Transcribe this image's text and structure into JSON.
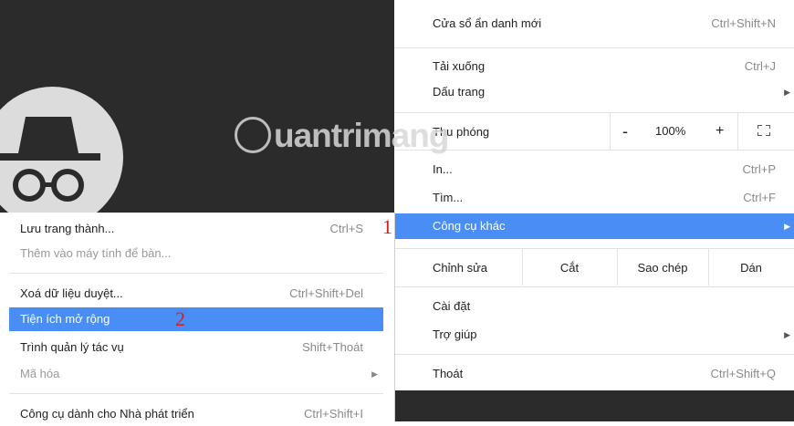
{
  "watermark": {
    "text": "uantrimang"
  },
  "main_menu": {
    "new_incognito": {
      "label": "Cửa sổ ẩn danh mới",
      "shortcut": "Ctrl+Shift+N"
    },
    "downloads": {
      "label": "Tải xuống",
      "shortcut": "Ctrl+J"
    },
    "bookmarks": {
      "label": "Dấu trang"
    },
    "zoom": {
      "label": "Thu phóng",
      "minus": "-",
      "value": "100%",
      "plus": "+"
    },
    "print": {
      "label": "In...",
      "shortcut": "Ctrl+P"
    },
    "find": {
      "label": "Tìm...",
      "shortcut": "Ctrl+F"
    },
    "more_tools": {
      "label": "Công cụ khác"
    },
    "edit": {
      "label": "Chỉnh sửa",
      "cut": "Cắt",
      "copy": "Sao chép",
      "paste": "Dán"
    },
    "settings": {
      "label": "Cài đặt"
    },
    "help": {
      "label": "Trợ giúp"
    },
    "exit": {
      "label": "Thoát",
      "shortcut": "Ctrl+Shift+Q"
    }
  },
  "sub_menu": {
    "save_page": {
      "label": "Lưu trang thành...",
      "shortcut": "Ctrl+S"
    },
    "add_desktop": {
      "label": "Thêm vào máy tính để bàn..."
    },
    "clear_data": {
      "label": "Xoá dữ liệu duyệt...",
      "shortcut": "Ctrl+Shift+Del"
    },
    "extensions": {
      "label": "Tiện ích mở rộng"
    },
    "task_manager": {
      "label": "Trình quản lý tác vụ",
      "shortcut": "Shift+Thoát"
    },
    "encoding": {
      "label": "Mã hóa"
    },
    "dev_tools": {
      "label": "Công cụ dành cho Nhà phát triển",
      "shortcut": "Ctrl+Shift+I"
    }
  },
  "annotations": {
    "step1": "1",
    "step2": "2"
  },
  "colors": {
    "highlight": "#4a8ef5",
    "marker": "#d42020",
    "incognito_bg": "#2b2b2b"
  }
}
